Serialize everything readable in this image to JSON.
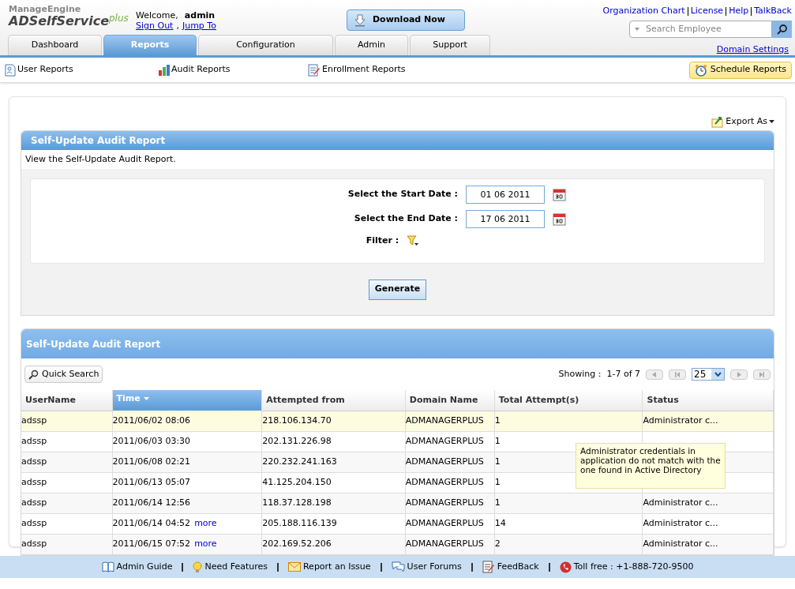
{
  "logo": {
    "brand": "ManageEngine",
    "product": "ADSelfService",
    "edition": "plus"
  },
  "welcome": {
    "greeting": "Welcome,",
    "user": "admin",
    "links": [
      "Sign Out",
      "Jump To"
    ],
    "separator": ","
  },
  "download_button": "Download Now",
  "top_links": [
    "Organization Chart",
    "License",
    "Help",
    "TalkBack"
  ],
  "search": {
    "placeholder": "Search Employee"
  },
  "domain_settings": "Domain Settings",
  "tabs": [
    {
      "label": "Dashboard",
      "selected": false
    },
    {
      "label": "Reports",
      "selected": true
    },
    {
      "label": "Configuration",
      "selected": false
    },
    {
      "label": "Admin",
      "selected": false
    },
    {
      "label": "Support",
      "selected": false
    }
  ],
  "subnav": [
    {
      "label": "User Reports",
      "kind": "user"
    },
    {
      "label": "Audit Reports",
      "kind": "chart"
    },
    {
      "label": "Enrollment Reports",
      "kind": "form"
    }
  ],
  "schedule_button": "Schedule Reports",
  "export": "Export As",
  "form_panel": {
    "title": "Self-Update Audit Report",
    "description": "View the Self-Update Audit Report.",
    "fields": [
      {
        "label": "Select the Start Date :",
        "value": "01 06 2011"
      },
      {
        "label": "Select the End Date :",
        "value": "17 06 2011"
      }
    ],
    "filter_label": "Filter :",
    "button": "Generate"
  },
  "report": {
    "title": "Self-Update Audit Report",
    "quick_search": "Quick Search",
    "showing_label": "Showing :",
    "showing_range": "1-7 of 7",
    "page_size": "25",
    "columns": [
      {
        "label": "UserName",
        "sorted": false
      },
      {
        "label": "Time",
        "sorted": true
      },
      {
        "label": "Attempted from",
        "sorted": false
      },
      {
        "label": "Domain Name",
        "sorted": false
      },
      {
        "label": "Total Attempt(s)",
        "sorted": false
      },
      {
        "label": "Status",
        "sorted": false
      }
    ],
    "rows": [
      {
        "highlighted": true,
        "cells": [
          "adssp",
          "2011/06/02 08:06",
          "218.106.134.70",
          "ADMANAGERPLUS",
          "1",
          "Administrator c..."
        ]
      },
      {
        "highlighted": false,
        "cells": [
          "adssp",
          "2011/06/03 03:30",
          "202.131.226.98",
          "ADMANAGERPLUS",
          "1"
        ]
      },
      {
        "highlighted": false,
        "cells": [
          "adssp",
          "2011/06/08 02:21",
          "220.232.241.163",
          "ADMANAGERPLUS",
          "1"
        ]
      },
      {
        "highlighted": false,
        "cells": [
          "adssp",
          "2011/06/13 05:07",
          "41.125.204.150",
          "ADMANAGERPLUS",
          "1"
        ]
      },
      {
        "highlighted": false,
        "cells": [
          "adssp",
          "2011/06/14 12:56",
          "118.37.128.198",
          "ADMANAGERPLUS",
          "1",
          "Administrator c..."
        ]
      },
      {
        "highlighted": false,
        "more": "more",
        "cells": [
          "adssp",
          "2011/06/14 04:52",
          "205.188.116.139",
          "ADMANAGERPLUS",
          "14",
          "Administrator c..."
        ]
      },
      {
        "highlighted": false,
        "more": "more",
        "cells": [
          "adssp",
          "2011/06/15 07:52",
          "202.169.52.206",
          "ADMANAGERPLUS",
          "2",
          "Administrator c..."
        ]
      }
    ],
    "tooltip": "Administrator credentials in application do not match with the one found in Active Directory"
  },
  "footer": [
    {
      "label": "Admin Guide",
      "kind": "book"
    },
    {
      "label": "Need Features",
      "kind": "bulb"
    },
    {
      "label": "Report an Issue",
      "kind": "mail"
    },
    {
      "label": "User Forums",
      "kind": "chat"
    },
    {
      "label": "FeedBack",
      "kind": "note"
    },
    {
      "label": "Toll free : +1-888-720-9500",
      "kind": "phone"
    }
  ]
}
